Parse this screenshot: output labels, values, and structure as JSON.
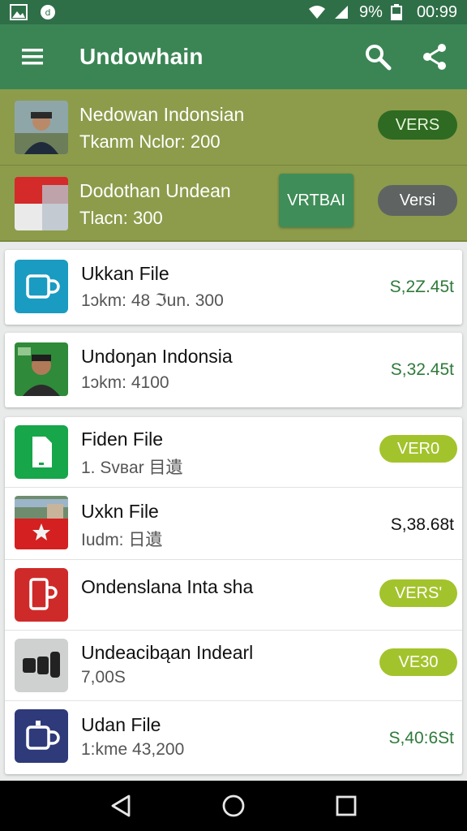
{
  "status_bar": {
    "battery": "9%",
    "time": "00:99"
  },
  "app_bar": {
    "title": "Undowhain"
  },
  "highlighted": [
    {
      "title": "Nedowan Indonsian",
      "subtitle": "Tkanm Nclor: 200",
      "badge": "VERS"
    },
    {
      "title": "Dodothan Undean",
      "subtitle": "Tlacn: 300",
      "action_button": "VRTBAI",
      "badge": "Versi"
    }
  ],
  "cards": [
    {
      "title": "Ukkan File",
      "subtitle": "1ↄkm: 48 ℑun. 300",
      "price": "S,2Z.45t"
    },
    {
      "title": "Undoŋan Indonsia",
      "subtitle": "1ↄkm: 4100",
      "price": "S,32.45t"
    }
  ],
  "list": [
    {
      "title": "Fiden File",
      "subtitle": "1. Svвar 目遺",
      "badge": "VER0"
    },
    {
      "title": "Uxkn File",
      "subtitle": "Iudm: 日遺",
      "price": "S,38.68t"
    },
    {
      "title": "Ondenslana Inta sha",
      "subtitle": "",
      "badge": "VERS'"
    },
    {
      "title": "Undeacibąan Indearl",
      "subtitle": "7,00S",
      "badge": "VE30"
    },
    {
      "title": "Udan File",
      "subtitle": "1:kme 43,200",
      "price": "S,40:6St"
    }
  ],
  "colors": {
    "app_bar": "#3b8555",
    "highlight_bg": "#8c9c4b",
    "price_green": "#2f7a3a",
    "badge_lime": "#a3c32c",
    "badge_dark_green": "#2e6a22"
  },
  "icons": {
    "menu": "menu-icon",
    "search": "search-icon",
    "share": "share-icon",
    "nav_back": "back-triangle-icon",
    "nav_home": "home-circle-icon",
    "nav_recents": "recents-square-icon"
  }
}
